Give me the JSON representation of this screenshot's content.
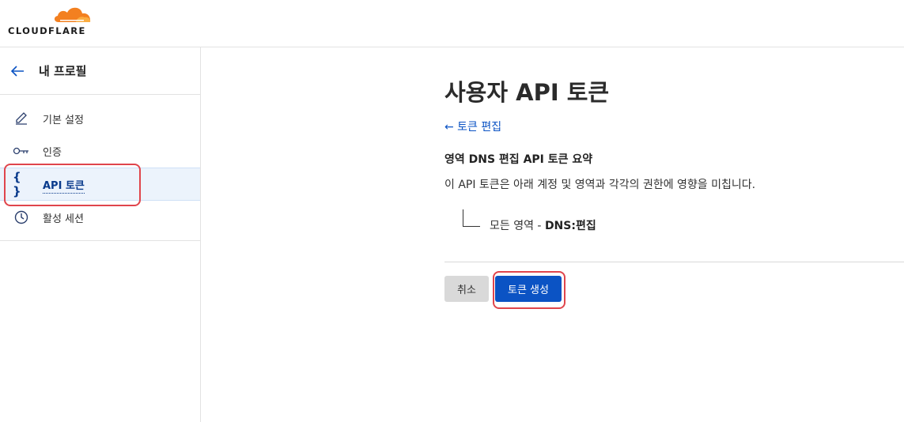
{
  "brand": {
    "logo_text": "CLOUDFLARE",
    "accent": "#f38020"
  },
  "sidebar": {
    "title": "내 프로필",
    "items": [
      {
        "label": "기본 설정",
        "icon": "pencil-icon"
      },
      {
        "label": "인증",
        "icon": "key-icon"
      },
      {
        "label": "API 토큰",
        "icon": "curly-braces-icon",
        "active": true
      },
      {
        "label": "활성 세션",
        "icon": "clock-icon"
      }
    ]
  },
  "main": {
    "title": "사용자 API 토큰",
    "back_link": "← 토큰 편집",
    "summary_title": "영역 DNS 편집 API 토큰 요약",
    "description": "이 API 토큰은 아래 계정 및 영역과 각각의 권한에 영향을 미칩니다.",
    "permission": {
      "scope": "모든 영역 - ",
      "perm": "DNS:편집"
    },
    "cancel_label": "취소",
    "create_label": "토큰 생성"
  },
  "colors": {
    "primary": "#0b53c4",
    "highlight": "#e0454c",
    "active_bg": "#ecf3fc"
  }
}
